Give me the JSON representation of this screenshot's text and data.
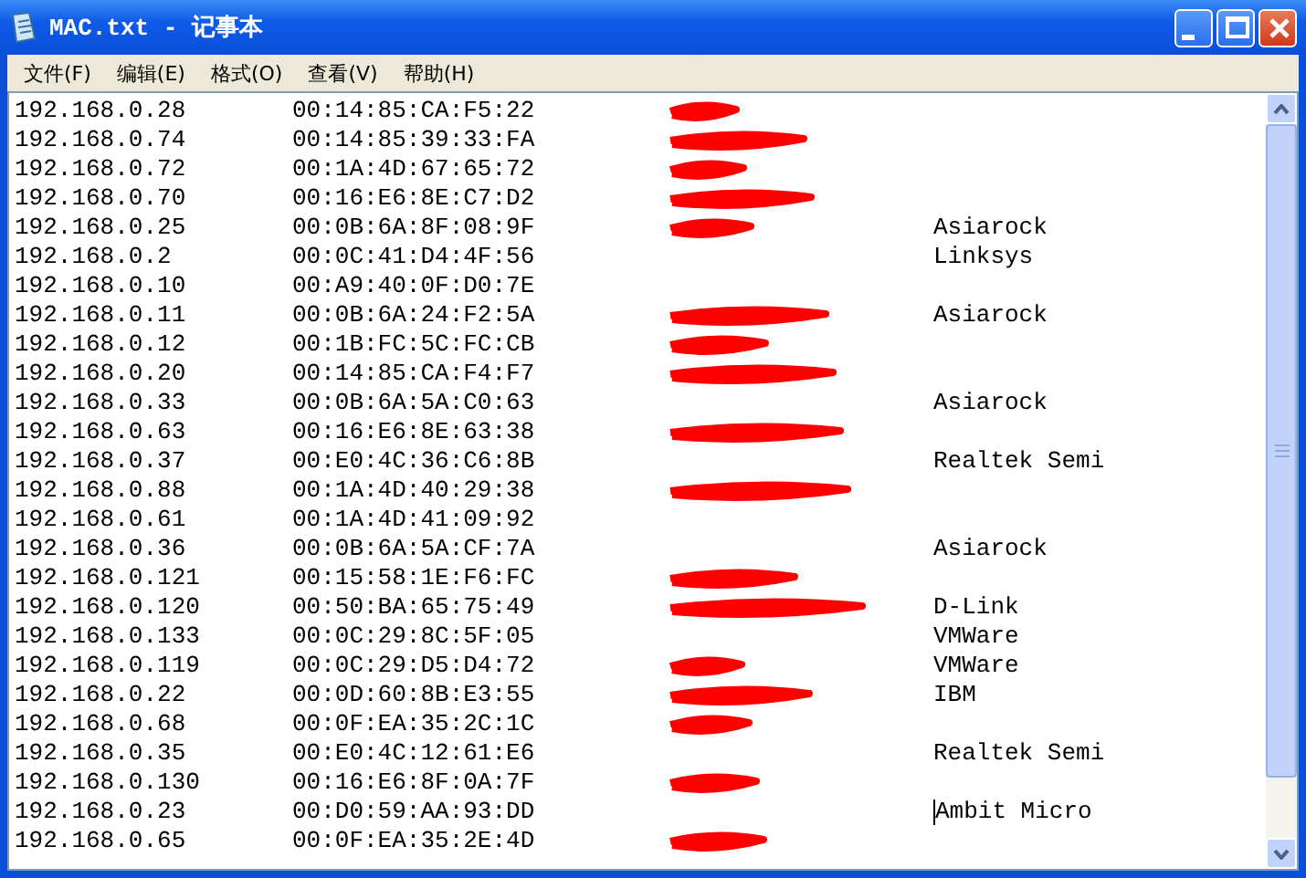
{
  "window": {
    "title": "MAC.txt - 记事本"
  },
  "menu": [
    {
      "label": "文件(F)"
    },
    {
      "label": "编辑(E)"
    },
    {
      "label": "格式(O)"
    },
    {
      "label": "查看(V)"
    },
    {
      "label": "帮助(H)"
    }
  ],
  "rows": [
    {
      "ip": "192.168.0.28",
      "mac": "00:14:85:CA:F5:22",
      "redacted": true
    },
    {
      "ip": "192.168.0.74",
      "mac": "00:14:85:39:33:FA",
      "redacted": true
    },
    {
      "ip": "192.168.0.72",
      "mac": "00:1A:4D:67:65:72",
      "redacted": true
    },
    {
      "ip": "192.168.0.70",
      "mac": "00:16:E6:8E:C7:D2",
      "redacted": true
    },
    {
      "ip": "192.168.0.25",
      "mac": "00:0B:6A:8F:08:9F",
      "redacted": true,
      "vendor": "Asiarock"
    },
    {
      "ip": "192.168.0.2",
      "mac": "00:0C:41:D4:4F:56",
      "redacted": false,
      "vendor": "Linksys"
    },
    {
      "ip": "192.168.0.10",
      "mac": "00:A9:40:0F:D0:7E",
      "redacted": false
    },
    {
      "ip": "192.168.0.11",
      "mac": "00:0B:6A:24:F2:5A",
      "redacted": true,
      "vendor": "Asiarock"
    },
    {
      "ip": "192.168.0.12",
      "mac": "00:1B:FC:5C:FC:CB",
      "redacted": true
    },
    {
      "ip": "192.168.0.20",
      "mac": "00:14:85:CA:F4:F7",
      "redacted": true
    },
    {
      "ip": "192.168.0.33",
      "mac": "00:0B:6A:5A:C0:63",
      "redacted": false,
      "vendor": "Asiarock"
    },
    {
      "ip": "192.168.0.63",
      "mac": "00:16:E6:8E:63:38",
      "redacted": true
    },
    {
      "ip": "192.168.0.37",
      "mac": "00:E0:4C:36:C6:8B",
      "redacted": false,
      "vendor": "Realtek Semi"
    },
    {
      "ip": "192.168.0.88",
      "mac": "00:1A:4D:40:29:38",
      "redacted": true
    },
    {
      "ip": "192.168.0.61",
      "mac": "00:1A:4D:41:09:92",
      "redacted": false
    },
    {
      "ip": "192.168.0.36",
      "mac": "00:0B:6A:5A:CF:7A",
      "redacted": false,
      "vendor": "Asiarock"
    },
    {
      "ip": "192.168.0.121",
      "mac": "00:15:58:1E:F6:FC",
      "redacted": true
    },
    {
      "ip": "192.168.0.120",
      "mac": "00:50:BA:65:75:49",
      "redacted": true,
      "vendor": "D-Link"
    },
    {
      "ip": "192.168.0.133",
      "mac": "00:0C:29:8C:5F:05",
      "redacted": false,
      "vendor": "VMWare"
    },
    {
      "ip": "192.168.0.119",
      "mac": "00:0C:29:D5:D4:72",
      "redacted": true,
      "vendor": "VMWare"
    },
    {
      "ip": "192.168.0.22",
      "mac": "00:0D:60:8B:E3:55",
      "redacted": true,
      "vendor": "IBM"
    },
    {
      "ip": "192.168.0.68",
      "mac": "00:0F:EA:35:2C:1C",
      "redacted": true
    },
    {
      "ip": "192.168.0.35",
      "mac": "00:E0:4C:12:61:E6",
      "redacted": false,
      "vendor": "Realtek Semi"
    },
    {
      "ip": "192.168.0.130",
      "mac": "00:16:E6:8F:0A:7F",
      "redacted": true
    },
    {
      "ip": "192.168.0.23",
      "mac": "00:D0:59:AA:93:DD",
      "redacted": false,
      "vendor": "Ambit Micro",
      "caret": true
    },
    {
      "ip": "192.168.0.65",
      "mac": "00:0F:EA:35:2E:4D",
      "redacted": true
    }
  ]
}
